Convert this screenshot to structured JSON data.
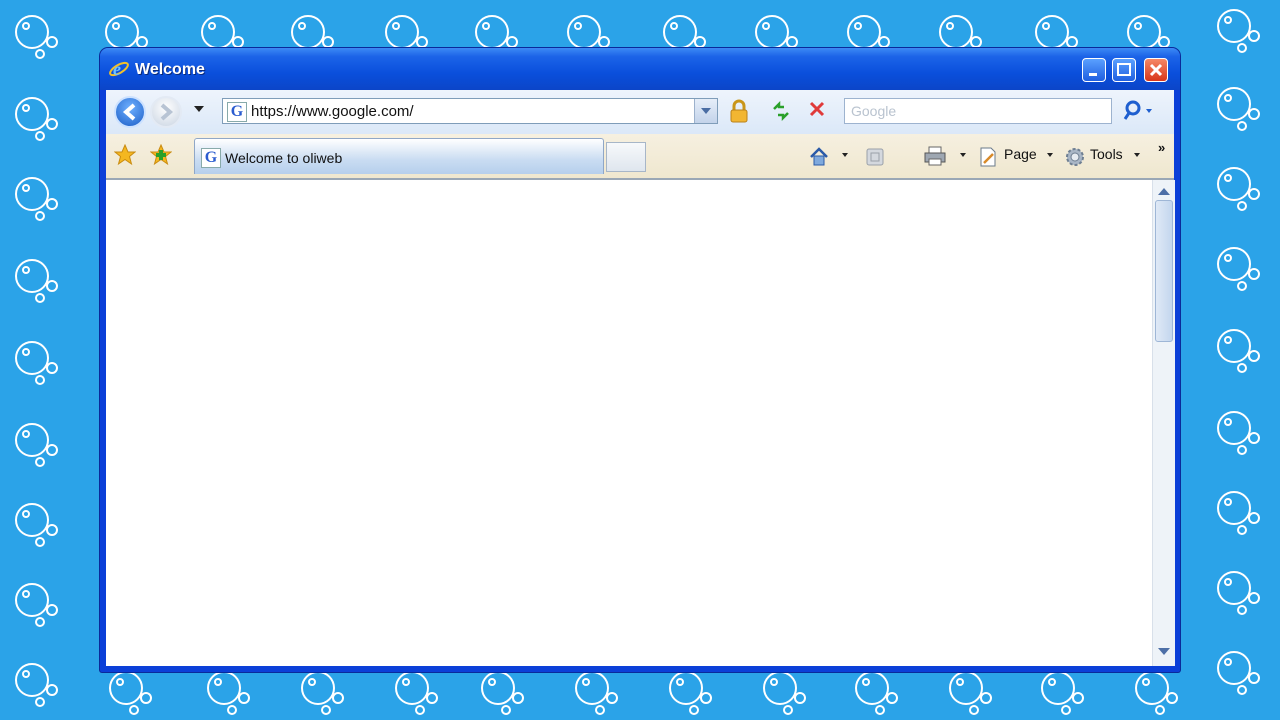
{
  "window": {
    "title": "Welcome"
  },
  "nav": {
    "address": "https://www.google.com/",
    "search_placeholder": "Google"
  },
  "tab": {
    "label": "Welcome to oliweb"
  },
  "commands": {
    "page": "Page",
    "tools": "Tools"
  },
  "colors": {
    "desktop": "#2ba3e8",
    "window_frame": "#0b3fd8",
    "close_button": "#d9361a"
  }
}
